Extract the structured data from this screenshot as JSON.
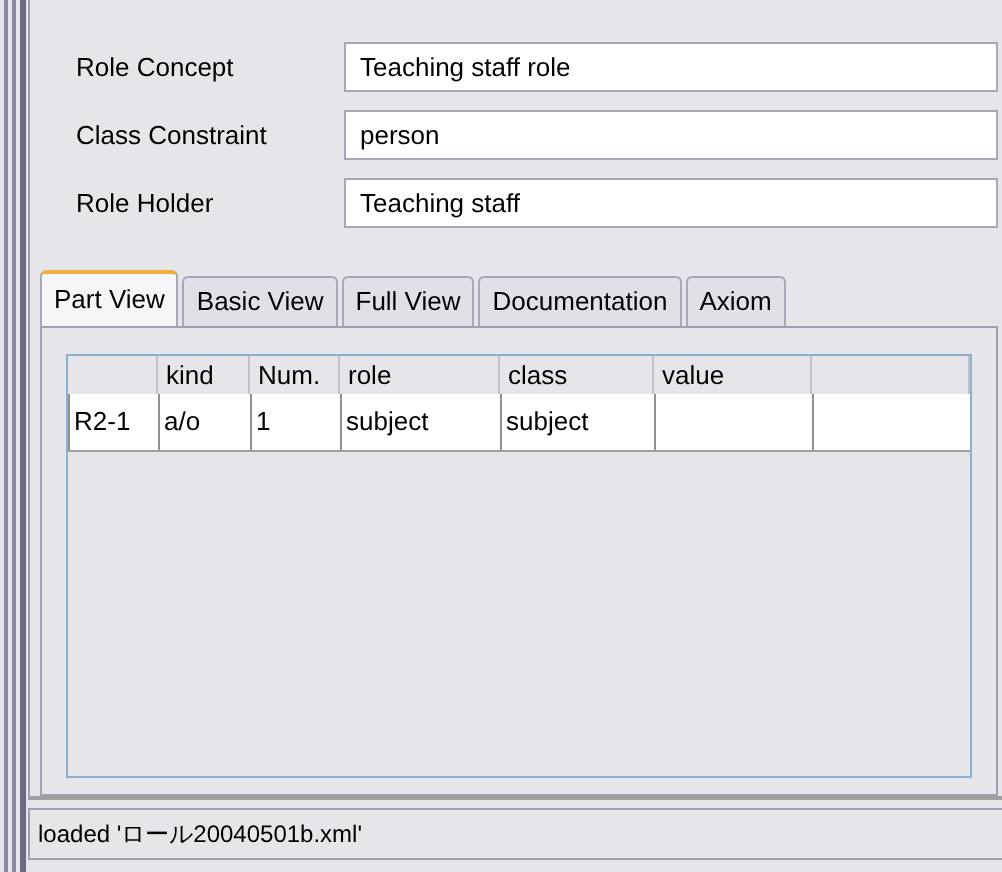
{
  "fields": [
    {
      "label": "Role Concept",
      "value": "Teaching staff role"
    },
    {
      "label": "Class Constraint",
      "value": "person"
    },
    {
      "label": "Role Holder",
      "value": "Teaching staff"
    }
  ],
  "tabs": [
    {
      "label": "Part View",
      "selected": true
    },
    {
      "label": "Basic View",
      "selected": false
    },
    {
      "label": "Full View",
      "selected": false
    },
    {
      "label": "Documentation",
      "selected": false
    },
    {
      "label": "Axiom",
      "selected": false
    }
  ],
  "table": {
    "columns": [
      "",
      "kind",
      "Num.",
      "role",
      "class",
      "value",
      ""
    ],
    "rows": [
      {
        "cells": [
          "R2-1",
          "a/o",
          "1",
          "subject",
          "subject",
          "",
          ""
        ]
      }
    ]
  },
  "status_bar": "loaded 'ロール20040501b.xml'"
}
